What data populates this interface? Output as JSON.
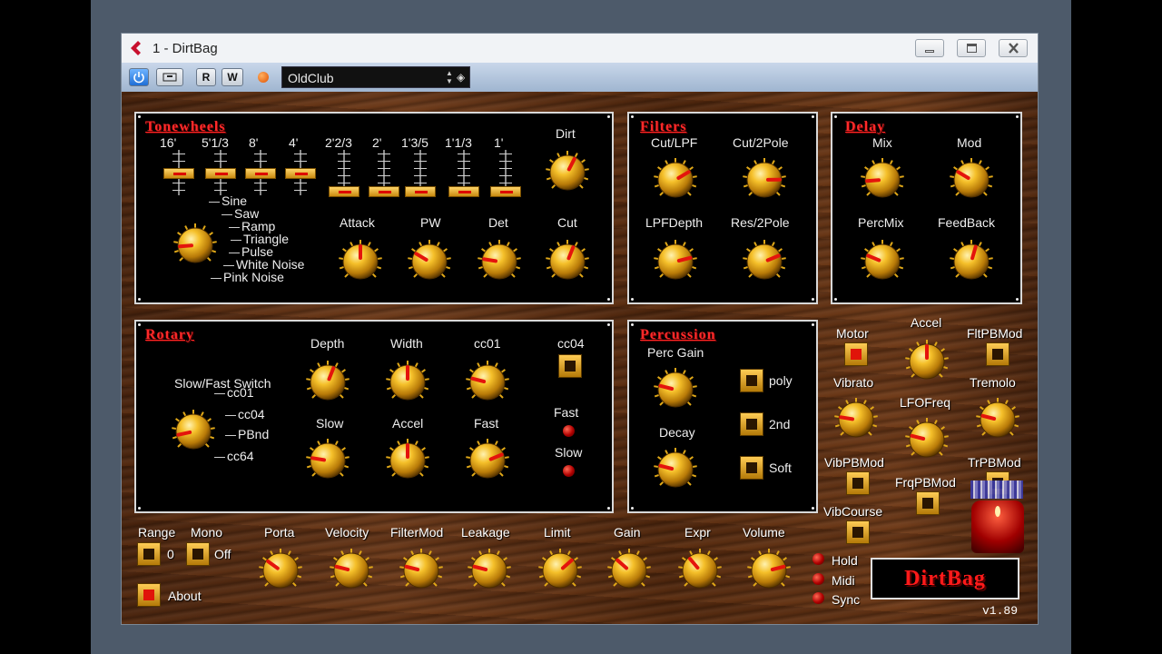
{
  "window": {
    "title": "1 - DirtBag"
  },
  "toolbar": {
    "read_label": "R",
    "write_label": "W",
    "preset": "OldClub"
  },
  "tonewheels": {
    "title": "Tonewheels",
    "drawbars": [
      "16'",
      "5'1/3",
      "8'",
      "4'",
      "2'2/3",
      "2'",
      "1'3/5",
      "1'1/3",
      "1'"
    ],
    "dirt_label": "Dirt",
    "waveforms": [
      "Sine",
      "Saw",
      "Ramp",
      "Triangle",
      "Pulse",
      "White Noise",
      "Pink Noise"
    ],
    "knobs": [
      "Attack",
      "PW",
      "Det",
      "Cut"
    ]
  },
  "filters": {
    "title": "Filters",
    "knobs": [
      "Cut/LPF",
      "Cut/2Pole",
      "LPFDepth",
      "Res/2Pole"
    ]
  },
  "delay": {
    "title": "Delay",
    "knobs": [
      "Mix",
      "Mod",
      "PercMix",
      "FeedBack"
    ]
  },
  "rotary": {
    "title": "Rotary",
    "switch_label": "Slow/Fast Switch",
    "switch_options": [
      "cc01",
      "cc04",
      "PBnd",
      "cc64"
    ],
    "knobs": [
      "Depth",
      "Width",
      "cc01",
      "Slow",
      "Accel",
      "Fast"
    ],
    "cc04_label": "cc04",
    "fast_label": "Fast",
    "slow_label": "Slow"
  },
  "percussion": {
    "title": "Percussion",
    "gain_label": "Perc Gain",
    "decay_label": "Decay",
    "buttons": [
      "poly",
      "2nd",
      "Soft"
    ]
  },
  "side": {
    "motor": "Motor",
    "accel": "Accel",
    "fltpbmod": "FltPBMod",
    "vibrato": "Vibrato",
    "lfofreq": "LFOFreq",
    "tremolo": "Tremolo",
    "vibpbmod": "VibPBMod",
    "frqpbmod": "FrqPBMod",
    "trpbmod": "TrPBMod",
    "vibcourse": "VibCourse"
  },
  "bottom": {
    "range_label": "Range",
    "range_value": "0",
    "mono_label": "Mono",
    "mono_value": "Off",
    "about_label": "About",
    "knobs": [
      "Porta",
      "Velocity",
      "FilterMod",
      "Leakage",
      "Limit",
      "Gain",
      "Expr",
      "Volume"
    ],
    "leds": [
      "Hold",
      "Midi",
      "Sync"
    ]
  },
  "brand": {
    "name": "DirtBag",
    "version": "v1.89"
  }
}
